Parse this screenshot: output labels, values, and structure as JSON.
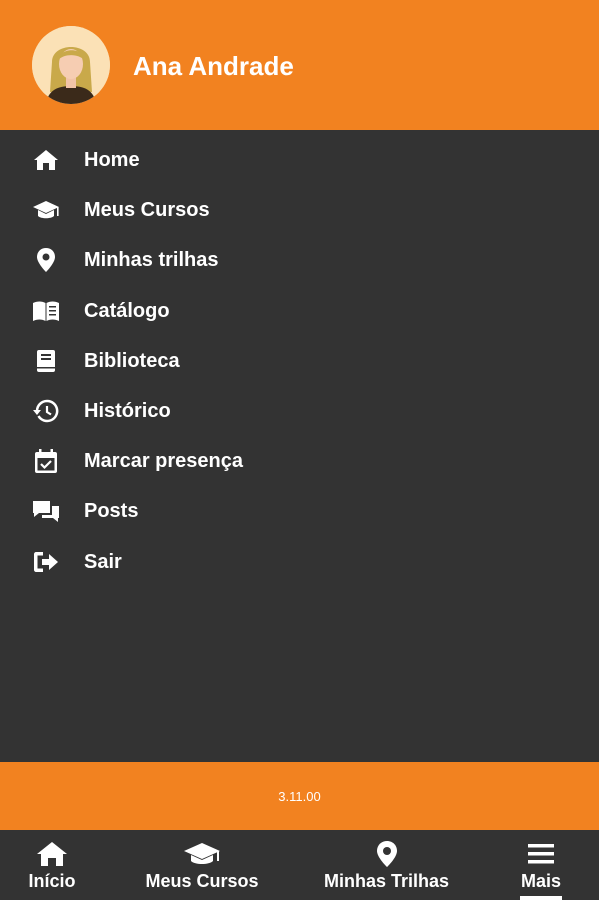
{
  "header": {
    "user_name": "Ana Andrade",
    "background_color": "#f28220"
  },
  "menu": {
    "items": [
      {
        "label": "Home",
        "icon": "home-icon"
      },
      {
        "label": "Meus Cursos",
        "icon": "graduation-cap-icon"
      },
      {
        "label": "Minhas trilhas",
        "icon": "map-pin-icon"
      },
      {
        "label": "Catálogo",
        "icon": "open-book-icon"
      },
      {
        "label": "Biblioteca",
        "icon": "book-icon"
      },
      {
        "label": "Histórico",
        "icon": "history-icon"
      },
      {
        "label": "Marcar presença",
        "icon": "calendar-check-icon"
      },
      {
        "label": "Posts",
        "icon": "chat-bubbles-icon"
      },
      {
        "label": "Sair",
        "icon": "sign-out-icon"
      }
    ]
  },
  "footer": {
    "version": "3.11.00"
  },
  "bottom_nav": {
    "items": [
      {
        "label": "Início",
        "icon": "home-icon"
      },
      {
        "label": "Meus Cursos",
        "icon": "graduation-cap-icon"
      },
      {
        "label": "Minhas Trilhas",
        "icon": "map-pin-icon"
      },
      {
        "label": "Mais",
        "icon": "hamburger-menu-icon",
        "active": true
      }
    ]
  },
  "colors": {
    "accent": "#f28220",
    "background": "#333333",
    "text": "#ffffff"
  }
}
